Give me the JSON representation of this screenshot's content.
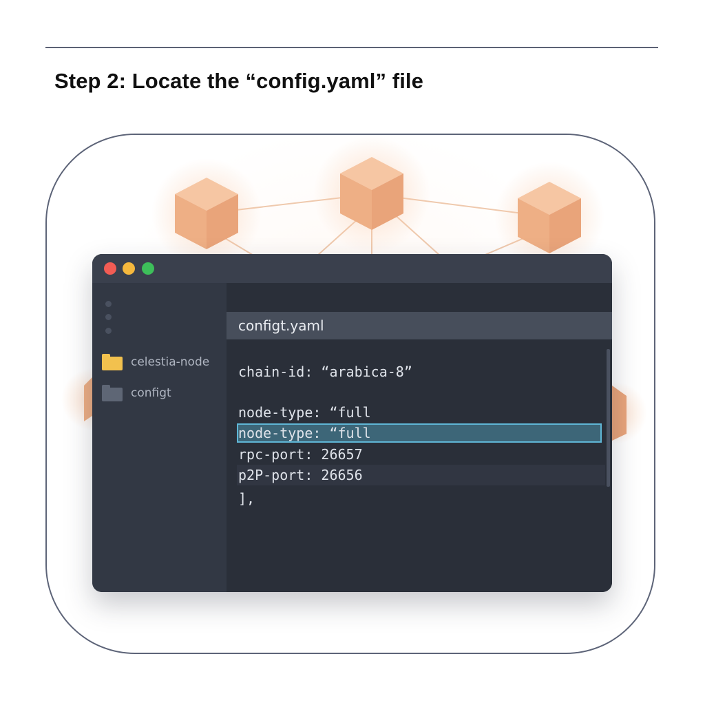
{
  "page": {
    "step_title": "Step 2: Locate the “config.yaml” file"
  },
  "colors": {
    "node_cube": "#f0b48a",
    "editor_bg": "#2b303b",
    "highlight_border": "#5fb6d6",
    "folder_active": "#f2c14e"
  },
  "editor": {
    "window_controls": [
      "close",
      "minimize",
      "maximize"
    ],
    "sidebar": {
      "items": [
        {
          "label": "celestia-node",
          "icon": "folder-icon"
        },
        {
          "label": "configt",
          "icon": "folder-icon"
        }
      ]
    },
    "tab": {
      "label": "configt.yaml"
    },
    "lines": [
      "chain-id: “arabica-8”",
      "node-type: “full",
      "node-type: “full",
      "rpc-port: 26657",
      "p2P-port: 26656",
      "],"
    ]
  }
}
